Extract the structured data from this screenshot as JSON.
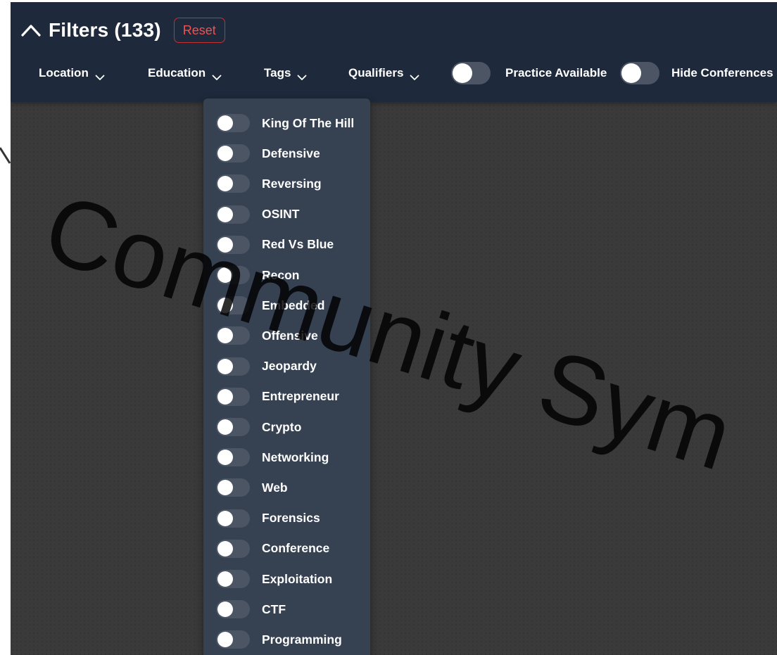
{
  "header": {
    "title": "Filters (133)",
    "reset_label": "Reset"
  },
  "filter_bar": {
    "location_label": "Location",
    "education_label": "Education",
    "tags_label": "Tags",
    "qualifiers_label": "Qualifiers",
    "practice_label": "Practice Available",
    "hide_conferences_label": "Hide Conferences",
    "practice_toggle_on": false,
    "hide_conferences_toggle_on": false
  },
  "tags_dropdown": {
    "items": [
      {
        "label": "King Of The Hill",
        "on": false
      },
      {
        "label": "Defensive",
        "on": false
      },
      {
        "label": "Reversing",
        "on": false
      },
      {
        "label": "OSINT",
        "on": false
      },
      {
        "label": "Red Vs Blue",
        "on": false
      },
      {
        "label": "Recon",
        "on": false
      },
      {
        "label": "Embedded",
        "on": false
      },
      {
        "label": "Offensive",
        "on": false
      },
      {
        "label": "Jeopardy",
        "on": false
      },
      {
        "label": "Entrepreneur",
        "on": false
      },
      {
        "label": "Crypto",
        "on": false
      },
      {
        "label": "Networking",
        "on": false
      },
      {
        "label": "Web",
        "on": false
      },
      {
        "label": "Forensics",
        "on": false
      },
      {
        "label": "Conference",
        "on": false
      },
      {
        "label": "Exploitation",
        "on": false
      },
      {
        "label": "CTF",
        "on": false
      },
      {
        "label": "Programming",
        "on": false
      }
    ]
  },
  "watermark": {
    "text": "Community Sym"
  },
  "colors": {
    "header_bg": "#1e293b",
    "dropdown_bg": "#364152",
    "reset_red": "#f05252",
    "toggle_off": "#4b5563",
    "page_bg": "#3a3a3a"
  }
}
